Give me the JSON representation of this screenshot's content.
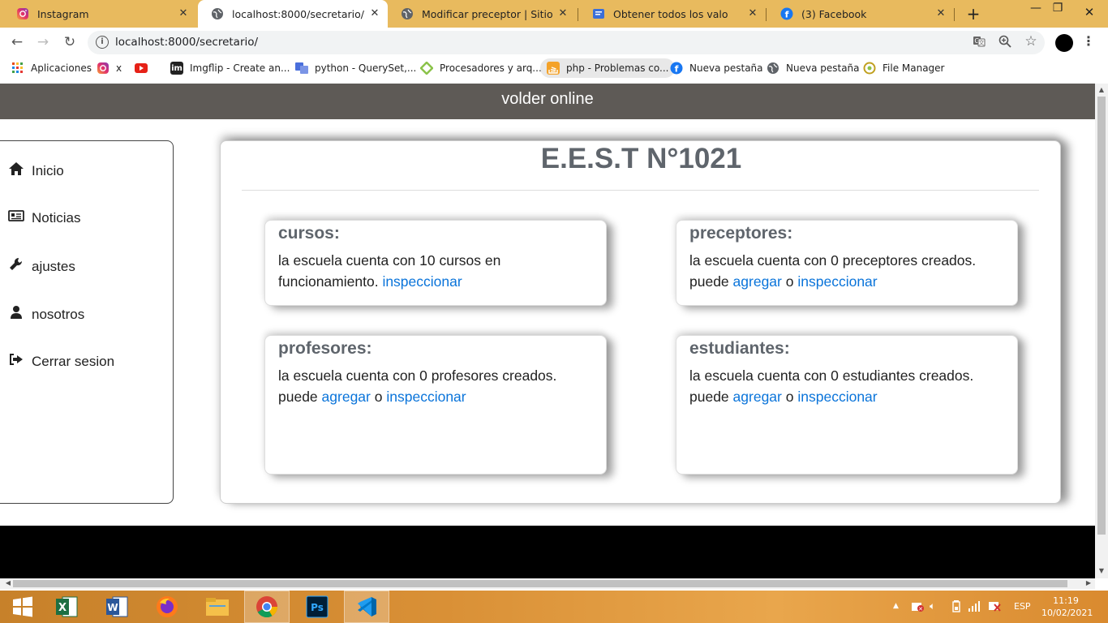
{
  "browser": {
    "tabs": [
      {
        "label": "Instagram",
        "icon": "instagram-icon",
        "active": false
      },
      {
        "label": "localhost:8000/secretario/",
        "icon": "globe-icon",
        "active": true
      },
      {
        "label": "Modificar preceptor | Sitio de ad",
        "icon": "globe-icon",
        "active": false
      },
      {
        "label": "Obtener todos los valores de un",
        "icon": "doc-icon",
        "active": false
      },
      {
        "label": "(3) Facebook",
        "icon": "facebook-icon",
        "active": false
      }
    ],
    "url": "localhost:8000/secretario/",
    "bookmarks": [
      {
        "label": "Aplicaciones",
        "icon": "apps-grid-icon"
      },
      {
        "label": "x",
        "icon": "instagram-icon"
      },
      {
        "label": "",
        "icon": "youtube-icon"
      },
      {
        "label": "Imgflip - Create an...",
        "icon": "imgflip-icon"
      },
      {
        "label": "python - QuerySet,...",
        "icon": "translate-icon"
      },
      {
        "label": "Procesadores y arq...",
        "icon": "diamond-icon"
      },
      {
        "label": "php - Problemas co...",
        "icon": "stackoverflow-icon"
      },
      {
        "label": "Nueva pestaña",
        "icon": "facebook-icon"
      },
      {
        "label": "Nueva pestaña",
        "icon": "globe-icon"
      },
      {
        "label": "File Manager",
        "icon": "filemanager-icon"
      }
    ]
  },
  "site": {
    "brand": "volder online",
    "sidebar": [
      {
        "label": "Inicio",
        "icon": "home-icon"
      },
      {
        "label": "Noticias",
        "icon": "newspaper-icon"
      },
      {
        "label": "ajustes",
        "icon": "wrench-icon"
      },
      {
        "label": "nosotros",
        "icon": "user-icon"
      },
      {
        "label": "Cerrar sesion",
        "icon": "sign-out-icon"
      }
    ],
    "school_title": "E.E.S.T N°1021",
    "cards": {
      "cursos": {
        "title": "cursos:",
        "text": "la escuela cuenta con 10 cursos en funcionamiento.",
        "link_inspect": "inspeccionar"
      },
      "preceptores": {
        "title": "preceptores:",
        "text": "la escuela cuenta con 0 preceptores creados.",
        "puede": "puede",
        "link_add": "agregar",
        "o": "o",
        "link_inspect": "inspeccionar"
      },
      "profesores": {
        "title": "profesores:",
        "text": "la escuela cuenta con 0 profesores creados.",
        "puede": "puede",
        "link_add": "agregar",
        "o": "o",
        "link_inspect": "inspeccionar"
      },
      "estudiantes": {
        "title": "estudiantes:",
        "text": "la escuela cuenta con 0 estudiantes creados.",
        "puede": "puede",
        "link_add": "agregar",
        "o": "o",
        "link_inspect": "inspeccionar"
      }
    },
    "link_color": "#0a74da",
    "header_color": "#5e5a56"
  },
  "taskbar": {
    "apps": [
      "windows-start-icon",
      "excel-icon",
      "word-icon",
      "firefox-icon",
      "file-explorer-icon",
      "chrome-icon",
      "photoshop-icon",
      "vscode-icon"
    ],
    "language": "ESP",
    "time": "11:19",
    "date": "10/02/2021"
  }
}
